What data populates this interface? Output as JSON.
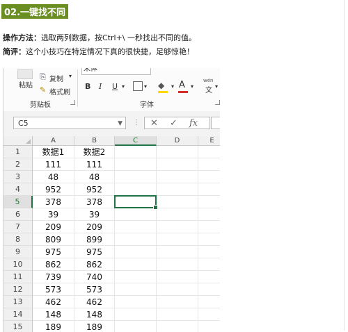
{
  "article": {
    "headline": "02.一键找不同",
    "method_label": "操作方法：",
    "method_text": "选取两列数据，按Ctrl+\\ 一秒找出不同的值。",
    "review_label": "简评：",
    "review_text": "这个小技巧在特定情况下真的很快捷，足够惊艳！"
  },
  "ribbon": {
    "paste_label": "粘贴",
    "copy_label": "复制",
    "format_painter_label": "格式刷",
    "clipboard_group_label": "剪贴板",
    "font_name_value": "宋体",
    "bold": "B",
    "italic": "I",
    "underline": "U",
    "font_group_label": "字体",
    "wen_label": "wén",
    "wen_char": "文"
  },
  "formula_bar": {
    "name_box_value": "C5",
    "fx_label": "fx"
  },
  "sheet": {
    "columns": [
      "A",
      "B",
      "C",
      "D",
      "E"
    ],
    "rows": [
      {
        "n": "1",
        "a": "数据1",
        "b": "数据2"
      },
      {
        "n": "2",
        "a": "111",
        "b": "111"
      },
      {
        "n": "3",
        "a": "48",
        "b": "48"
      },
      {
        "n": "4",
        "a": "952",
        "b": "952"
      },
      {
        "n": "5",
        "a": "378",
        "b": "378"
      },
      {
        "n": "6",
        "a": "39",
        "b": "39"
      },
      {
        "n": "7",
        "a": "209",
        "b": "209"
      },
      {
        "n": "8",
        "a": "809",
        "b": "899"
      },
      {
        "n": "9",
        "a": "975",
        "b": "975"
      },
      {
        "n": "10",
        "a": "862",
        "b": "862"
      },
      {
        "n": "11",
        "a": "739",
        "b": "740"
      },
      {
        "n": "12",
        "a": "573",
        "b": "573"
      },
      {
        "n": "13",
        "a": "462",
        "b": "462"
      },
      {
        "n": "14",
        "a": "148",
        "b": "148"
      },
      {
        "n": "15",
        "a": "189",
        "b": "189"
      }
    ],
    "selected_cell": "C5"
  }
}
